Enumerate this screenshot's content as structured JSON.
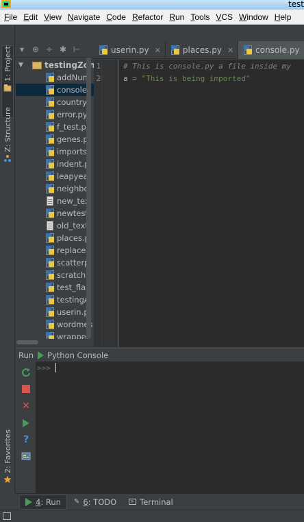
{
  "window": {
    "title": "test"
  },
  "menu": [
    {
      "mn": "F",
      "rest": "ile"
    },
    {
      "mn": "E",
      "rest": "dit"
    },
    {
      "mn": "V",
      "rest": "iew"
    },
    {
      "mn": "N",
      "rest": "avigate"
    },
    {
      "mn": "C",
      "rest": "ode"
    },
    {
      "mn": "R",
      "rest": "efactor"
    },
    {
      "mn": "R",
      "rest": "un"
    },
    {
      "mn": "T",
      "rest": "ools"
    },
    {
      "mn": "V",
      "rest": "CS"
    },
    {
      "mn": "W",
      "rest": "indow"
    },
    {
      "mn": "H",
      "rest": "elp"
    }
  ],
  "left_stripe": {
    "project_tab": "1: Project",
    "structure_tab": "Z: Structure",
    "favorites_tab": "2: Favorites"
  },
  "project": {
    "root": "testingZone",
    "files": [
      {
        "name": "addNum",
        "type": "py"
      },
      {
        "name": "console.",
        "type": "py",
        "selected": true
      },
      {
        "name": "country_",
        "type": "py"
      },
      {
        "name": "error.py",
        "type": "py"
      },
      {
        "name": "f_test.p",
        "type": "py"
      },
      {
        "name": "genes.p",
        "type": "py"
      },
      {
        "name": "imports.",
        "type": "py"
      },
      {
        "name": "indent.p",
        "type": "py"
      },
      {
        "name": "leapyear",
        "type": "py"
      },
      {
        "name": "neighbo",
        "type": "py"
      },
      {
        "name": "new_tex",
        "type": "txt"
      },
      {
        "name": "newtest",
        "type": "py"
      },
      {
        "name": "old_text",
        "type": "txt"
      },
      {
        "name": "places.p",
        "type": "py"
      },
      {
        "name": "replace.",
        "type": "py"
      },
      {
        "name": "scatterp",
        "type": "py"
      },
      {
        "name": "scratchp",
        "type": "py"
      },
      {
        "name": "test_flas",
        "type": "py"
      },
      {
        "name": "testingA",
        "type": "py"
      },
      {
        "name": "userin.p",
        "type": "py"
      },
      {
        "name": "wordmes",
        "type": "py"
      },
      {
        "name": "wrapper",
        "type": "py"
      }
    ]
  },
  "editor": {
    "tabs": [
      {
        "label": "userin.py",
        "active": false
      },
      {
        "label": "places.py",
        "active": false
      },
      {
        "label": "console.py",
        "active": true
      }
    ],
    "line_numbers": [
      "1",
      "2"
    ],
    "comment": "# This is console.py a file inside my",
    "line2": {
      "ident": "a",
      "op": " = ",
      "str": "\"This is being imported\""
    }
  },
  "run": {
    "label": "Run",
    "config": "Python Console",
    "prompt": ">>>"
  },
  "bottom_tabs": [
    {
      "mn": "4",
      "rest": ": Run",
      "active": true
    },
    {
      "mn": "6",
      "rest": ": TODO",
      "active": false
    },
    {
      "mn": "",
      "rest": "Terminal",
      "active": false
    }
  ],
  "colors": {
    "accent_green": "#499c54",
    "selection": "#0d293e",
    "comment": "#808080",
    "string": "#6a8759",
    "keyword": "#cc7832"
  }
}
